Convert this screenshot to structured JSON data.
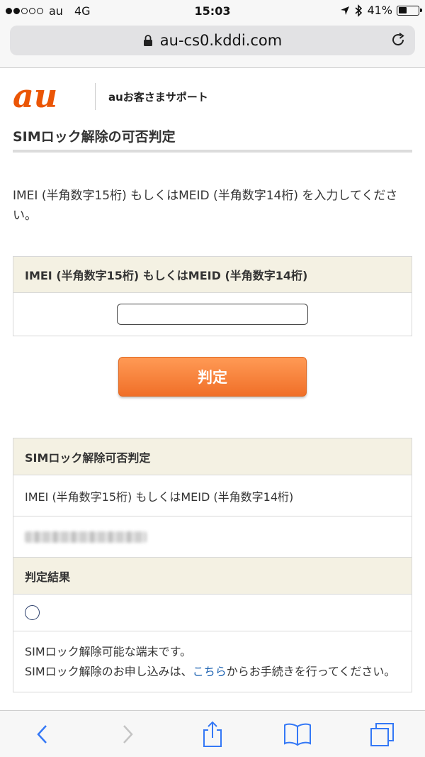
{
  "status_bar": {
    "carrier": "au",
    "network": "4G",
    "time": "15:03",
    "battery_percent": "41%",
    "battery_level": 0.41,
    "signal_bars_filled": 2,
    "signal_bars_total": 5
  },
  "url_bar": {
    "domain": "au-cs0.kddi.com",
    "lock_icon": "lock-icon",
    "reload_icon": "reload-icon"
  },
  "header": {
    "logo_text": "au",
    "support_label": "auお客さまサポート",
    "page_title": "SIMロック解除の可否判定"
  },
  "instruction": "IMEI (半角数字15桁) もしくはMEID (半角数字14桁) を入力してください。",
  "form": {
    "header": "IMEI (半角数字15桁) もしくはMEID (半角数字14桁)",
    "input_value": "",
    "submit_label": "判定"
  },
  "result": {
    "title": "SIMロック解除可否判定",
    "imei_label": "IMEI (半角数字15桁) もしくはMEID (半角数字14桁)",
    "result_label": "判定結果",
    "result_symbol": "circle-icon",
    "message_line1": "SIMロック解除可能な端末です。",
    "message_pre": "SIMロック解除のお申し込みは、",
    "message_link": "こちら",
    "message_post": "からお手続きを行ってください。"
  },
  "toolbar": {
    "back_icon": "chevron-left-icon",
    "forward_icon": "chevron-right-icon",
    "share_icon": "share-icon",
    "bookmarks_icon": "book-icon",
    "tabs_icon": "tabs-icon"
  },
  "colors": {
    "accent": "#f06f28",
    "logo": "#eb5505",
    "table_header_bg": "#f4f1e3",
    "link": "#2266b3",
    "ios_blue": "#3478f6"
  }
}
